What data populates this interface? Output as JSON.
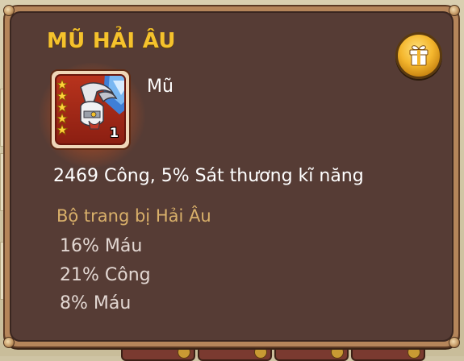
{
  "item": {
    "title": "MŨ HẢI ÂU",
    "type": "Mũ",
    "level": "1",
    "stars": 5,
    "main_stats": "2469 Công, 5% Sát thương kĩ năng"
  },
  "set": {
    "name": "Bộ trang bị Hải Âu",
    "bonuses": [
      "16% Máu",
      "21% Công",
      "8% Máu"
    ]
  },
  "icons": {
    "gift": "gift-icon",
    "helmet": "seagull-helmet-icon",
    "star": "star-icon"
  },
  "colors": {
    "title": "#f5c22c",
    "set_name": "#d9b06a",
    "panel_bg": "#563c35",
    "frame": "#b5855a"
  }
}
